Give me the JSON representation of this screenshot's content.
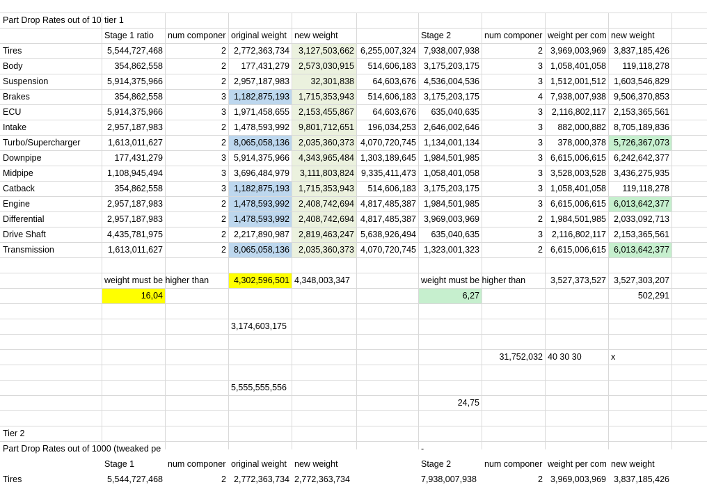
{
  "colors": {
    "grid": "#d9d9d9",
    "yellow": "#ffff00",
    "green_light": "#c6efce",
    "blue": "#bdd7ee",
    "olive": "#ebf1de"
  },
  "rows": [
    [
      {
        "c": 0,
        "t": "Part Drop Rates out of 10"
      },
      {
        "c": 1,
        "t": "tier 1",
        "a": "l"
      }
    ],
    [
      {
        "c": 1,
        "t": "Stage 1 ratio",
        "a": "l"
      },
      {
        "c": 2,
        "t": "num componer",
        "a": "l"
      },
      {
        "c": 3,
        "t": "original weight",
        "a": "l"
      },
      {
        "c": 4,
        "t": "new weight",
        "a": "l"
      },
      {
        "c": 6,
        "t": "Stage 2",
        "a": "l"
      },
      {
        "c": 7,
        "t": "num componer",
        "a": "l"
      },
      {
        "c": 8,
        "t": "weight per com",
        "a": "l"
      },
      {
        "c": 9,
        "t": "new weight",
        "a": "l"
      }
    ],
    [
      {
        "c": 0,
        "t": "Tires"
      },
      {
        "c": 1,
        "t": "5,544,727,468",
        "a": "r"
      },
      {
        "c": 2,
        "t": "2",
        "a": "r"
      },
      {
        "c": 3,
        "t": "2,772,363,734",
        "a": "r"
      },
      {
        "c": 4,
        "t": "3,127,503,662",
        "a": "r",
        "bg": "olive"
      },
      {
        "c": 5,
        "t": "6,255,007,324",
        "a": "r"
      },
      {
        "c": 6,
        "t": "7,938,007,938",
        "a": "r"
      },
      {
        "c": 7,
        "t": "2",
        "a": "r"
      },
      {
        "c": 8,
        "t": "3,969,003,969",
        "a": "r"
      },
      {
        "c": 9,
        "t": "3,837,185,426",
        "a": "r"
      }
    ],
    [
      {
        "c": 0,
        "t": "Body"
      },
      {
        "c": 1,
        "t": "354,862,558",
        "a": "r"
      },
      {
        "c": 2,
        "t": "2",
        "a": "r"
      },
      {
        "c": 3,
        "t": "177,431,279",
        "a": "r"
      },
      {
        "c": 4,
        "t": "2,573,030,915",
        "a": "r",
        "bg": "olive"
      },
      {
        "c": 5,
        "t": "514,606,183",
        "a": "r"
      },
      {
        "c": 6,
        "t": "3,175,203,175",
        "a": "r"
      },
      {
        "c": 7,
        "t": "3",
        "a": "r"
      },
      {
        "c": 8,
        "t": "1,058,401,058",
        "a": "r"
      },
      {
        "c": 9,
        "t": "119,118,278",
        "a": "r"
      }
    ],
    [
      {
        "c": 0,
        "t": "Suspension"
      },
      {
        "c": 1,
        "t": "5,914,375,966",
        "a": "r"
      },
      {
        "c": 2,
        "t": "2",
        "a": "r"
      },
      {
        "c": 3,
        "t": "2,957,187,983",
        "a": "r"
      },
      {
        "c": 4,
        "t": "32,301,838",
        "a": "r",
        "bg": "olive"
      },
      {
        "c": 5,
        "t": "64,603,676",
        "a": "r"
      },
      {
        "c": 6,
        "t": "4,536,004,536",
        "a": "r"
      },
      {
        "c": 7,
        "t": "3",
        "a": "r"
      },
      {
        "c": 8,
        "t": "1,512,001,512",
        "a": "r"
      },
      {
        "c": 9,
        "t": "1,603,546,829",
        "a": "r"
      }
    ],
    [
      {
        "c": 0,
        "t": "Brakes"
      },
      {
        "c": 1,
        "t": "354,862,558",
        "a": "r"
      },
      {
        "c": 2,
        "t": "3",
        "a": "r"
      },
      {
        "c": 3,
        "t": "1,182,875,193",
        "a": "r",
        "bg": "blue"
      },
      {
        "c": 4,
        "t": "1,715,353,943",
        "a": "r",
        "bg": "olive"
      },
      {
        "c": 5,
        "t": "514,606,183",
        "a": "r"
      },
      {
        "c": 6,
        "t": "3,175,203,175",
        "a": "r"
      },
      {
        "c": 7,
        "t": "4",
        "a": "r"
      },
      {
        "c": 8,
        "t": "7,938,007,938",
        "a": "r"
      },
      {
        "c": 9,
        "t": "9,506,370,853",
        "a": "r"
      }
    ],
    [
      {
        "c": 0,
        "t": "ECU"
      },
      {
        "c": 1,
        "t": "5,914,375,966",
        "a": "r"
      },
      {
        "c": 2,
        "t": "3",
        "a": "r"
      },
      {
        "c": 3,
        "t": "1,971,458,655",
        "a": "r"
      },
      {
        "c": 4,
        "t": "2,153,455,867",
        "a": "r",
        "bg": "olive"
      },
      {
        "c": 5,
        "t": "64,603,676",
        "a": "r"
      },
      {
        "c": 6,
        "t": "635,040,635",
        "a": "r"
      },
      {
        "c": 7,
        "t": "3",
        "a": "r"
      },
      {
        "c": 8,
        "t": "2,116,802,117",
        "a": "r"
      },
      {
        "c": 9,
        "t": "2,153,365,561",
        "a": "r"
      }
    ],
    [
      {
        "c": 0,
        "t": "Intake"
      },
      {
        "c": 1,
        "t": "2,957,187,983",
        "a": "r"
      },
      {
        "c": 2,
        "t": "2",
        "a": "r"
      },
      {
        "c": 3,
        "t": "1,478,593,992",
        "a": "r"
      },
      {
        "c": 4,
        "t": "9,801,712,651",
        "a": "r",
        "bg": "olive"
      },
      {
        "c": 5,
        "t": "196,034,253",
        "a": "r"
      },
      {
        "c": 6,
        "t": "2,646,002,646",
        "a": "r"
      },
      {
        "c": 7,
        "t": "3",
        "a": "r"
      },
      {
        "c": 8,
        "t": "882,000,882",
        "a": "r"
      },
      {
        "c": 9,
        "t": "8,705,189,836",
        "a": "r"
      }
    ],
    [
      {
        "c": 0,
        "t": "Turbo/Supercharger"
      },
      {
        "c": 1,
        "t": "1,613,011,627",
        "a": "r"
      },
      {
        "c": 2,
        "t": "2",
        "a": "r"
      },
      {
        "c": 3,
        "t": "8,065,058,136",
        "a": "r",
        "bg": "blue"
      },
      {
        "c": 4,
        "t": "2,035,360,373",
        "a": "r",
        "bg": "olive"
      },
      {
        "c": 5,
        "t": "4,070,720,745",
        "a": "r"
      },
      {
        "c": 6,
        "t": "1,134,001,134",
        "a": "r"
      },
      {
        "c": 7,
        "t": "3",
        "a": "r"
      },
      {
        "c": 8,
        "t": "378,000,378",
        "a": "r"
      },
      {
        "c": 9,
        "t": "5,726,367,073",
        "a": "r",
        "bg": "green_light"
      }
    ],
    [
      {
        "c": 0,
        "t": "Downpipe"
      },
      {
        "c": 1,
        "t": "177,431,279",
        "a": "r"
      },
      {
        "c": 2,
        "t": "3",
        "a": "r"
      },
      {
        "c": 3,
        "t": "5,914,375,966",
        "a": "r"
      },
      {
        "c": 4,
        "t": "4,343,965,484",
        "a": "r",
        "bg": "olive"
      },
      {
        "c": 5,
        "t": "1,303,189,645",
        "a": "r"
      },
      {
        "c": 6,
        "t": "1,984,501,985",
        "a": "r"
      },
      {
        "c": 7,
        "t": "3",
        "a": "r"
      },
      {
        "c": 8,
        "t": "6,615,006,615",
        "a": "r"
      },
      {
        "c": 9,
        "t": "6,242,642,377",
        "a": "r"
      }
    ],
    [
      {
        "c": 0,
        "t": "Midpipe"
      },
      {
        "c": 1,
        "t": "1,108,945,494",
        "a": "r"
      },
      {
        "c": 2,
        "t": "3",
        "a": "r"
      },
      {
        "c": 3,
        "t": "3,696,484,979",
        "a": "r"
      },
      {
        "c": 4,
        "t": "3,111,803,824",
        "a": "r",
        "bg": "olive"
      },
      {
        "c": 5,
        "t": "9,335,411,473",
        "a": "r"
      },
      {
        "c": 6,
        "t": "1,058,401,058",
        "a": "r"
      },
      {
        "c": 7,
        "t": "3",
        "a": "r"
      },
      {
        "c": 8,
        "t": "3,528,003,528",
        "a": "r"
      },
      {
        "c": 9,
        "t": "3,436,275,935",
        "a": "r"
      }
    ],
    [
      {
        "c": 0,
        "t": "Catback"
      },
      {
        "c": 1,
        "t": "354,862,558",
        "a": "r"
      },
      {
        "c": 2,
        "t": "3",
        "a": "r"
      },
      {
        "c": 3,
        "t": "1,182,875,193",
        "a": "r",
        "bg": "blue"
      },
      {
        "c": 4,
        "t": "1,715,353,943",
        "a": "r",
        "bg": "olive"
      },
      {
        "c": 5,
        "t": "514,606,183",
        "a": "r"
      },
      {
        "c": 6,
        "t": "3,175,203,175",
        "a": "r"
      },
      {
        "c": 7,
        "t": "3",
        "a": "r"
      },
      {
        "c": 8,
        "t": "1,058,401,058",
        "a": "r"
      },
      {
        "c": 9,
        "t": "119,118,278",
        "a": "r"
      }
    ],
    [
      {
        "c": 0,
        "t": "Engine"
      },
      {
        "c": 1,
        "t": "2,957,187,983",
        "a": "r"
      },
      {
        "c": 2,
        "t": "2",
        "a": "r"
      },
      {
        "c": 3,
        "t": "1,478,593,992",
        "a": "r",
        "bg": "blue"
      },
      {
        "c": 4,
        "t": "2,408,742,694",
        "a": "r",
        "bg": "olive"
      },
      {
        "c": 5,
        "t": "4,817,485,387",
        "a": "r"
      },
      {
        "c": 6,
        "t": "1,984,501,985",
        "a": "r"
      },
      {
        "c": 7,
        "t": "3",
        "a": "r"
      },
      {
        "c": 8,
        "t": "6,615,006,615",
        "a": "r"
      },
      {
        "c": 9,
        "t": "6,013,642,377",
        "a": "r",
        "bg": "green_light"
      }
    ],
    [
      {
        "c": 0,
        "t": "Differential"
      },
      {
        "c": 1,
        "t": "2,957,187,983",
        "a": "r"
      },
      {
        "c": 2,
        "t": "2",
        "a": "r"
      },
      {
        "c": 3,
        "t": "1,478,593,992",
        "a": "r",
        "bg": "blue"
      },
      {
        "c": 4,
        "t": "2,408,742,694",
        "a": "r",
        "bg": "olive"
      },
      {
        "c": 5,
        "t": "4,817,485,387",
        "a": "r"
      },
      {
        "c": 6,
        "t": "3,969,003,969",
        "a": "r"
      },
      {
        "c": 7,
        "t": "2",
        "a": "r"
      },
      {
        "c": 8,
        "t": "1,984,501,985",
        "a": "r"
      },
      {
        "c": 9,
        "t": "2,033,092,713",
        "a": "r"
      }
    ],
    [
      {
        "c": 0,
        "t": "Drive Shaft"
      },
      {
        "c": 1,
        "t": "4,435,781,975",
        "a": "r"
      },
      {
        "c": 2,
        "t": "2",
        "a": "r"
      },
      {
        "c": 3,
        "t": "2,217,890,987",
        "a": "r"
      },
      {
        "c": 4,
        "t": "2,819,463,247",
        "a": "r",
        "bg": "olive"
      },
      {
        "c": 5,
        "t": "5,638,926,494",
        "a": "r"
      },
      {
        "c": 6,
        "t": "635,040,635",
        "a": "r"
      },
      {
        "c": 7,
        "t": "3",
        "a": "r"
      },
      {
        "c": 8,
        "t": "2,116,802,117",
        "a": "r"
      },
      {
        "c": 9,
        "t": "2,153,365,561",
        "a": "r"
      }
    ],
    [
      {
        "c": 0,
        "t": "Transmission"
      },
      {
        "c": 1,
        "t": "1,613,011,627",
        "a": "r"
      },
      {
        "c": 2,
        "t": "2",
        "a": "r"
      },
      {
        "c": 3,
        "t": "8,065,058,136",
        "a": "r",
        "bg": "blue"
      },
      {
        "c": 4,
        "t": "2,035,360,373",
        "a": "r",
        "bg": "olive"
      },
      {
        "c": 5,
        "t": "4,070,720,745",
        "a": "r"
      },
      {
        "c": 6,
        "t": "1,323,001,323",
        "a": "r"
      },
      {
        "c": 7,
        "t": "2",
        "a": "r"
      },
      {
        "c": 8,
        "t": "6,615,006,615",
        "a": "r"
      },
      {
        "c": 9,
        "t": "6,013,642,377",
        "a": "r",
        "bg": "green_light"
      }
    ],
    [],
    [
      {
        "c": 1,
        "t": "weight must be higher than",
        "a": "l",
        "ovf": true
      },
      {
        "c": 3,
        "t": "4,302,596,501",
        "a": "r",
        "bg": "yellow"
      },
      {
        "c": 4,
        "t": "4,348,003,347",
        "a": "l"
      },
      {
        "c": 6,
        "t": "weight must be higher than",
        "a": "l",
        "ovf": true
      },
      {
        "c": 8,
        "t": "3,527,373,527",
        "a": "r"
      },
      {
        "c": 9,
        "t": "3,527,303,207",
        "a": "r"
      }
    ],
    [
      {
        "c": 1,
        "t": "16,04",
        "a": "r",
        "bg": "yellow"
      },
      {
        "c": 6,
        "t": "6,27",
        "a": "r",
        "bg": "green_light"
      },
      {
        "c": 9,
        "t": "502,291",
        "a": "r"
      }
    ],
    [],
    [
      {
        "c": 3,
        "t": "3,174,603,175",
        "a": "l"
      }
    ],
    [],
    [
      {
        "c": 7,
        "t": "31,752,032",
        "a": "r"
      },
      {
        "c": 8,
        "t": "40 30 30",
        "a": "l"
      },
      {
        "c": 9,
        "t": "x",
        "a": "l"
      }
    ],
    [],
    [
      {
        "c": 3,
        "t": "5,555,555,556",
        "a": "l"
      }
    ],
    [
      {
        "c": 5,
        "t": "24,75",
        "a": "r",
        "span": 2
      }
    ],
    [],
    [
      {
        "c": 0,
        "t": "Tier 2"
      }
    ],
    [
      {
        "c": 0,
        "t": "Part Drop Rates out of 1000 (tweaked pe",
        "span": 2
      },
      {
        "c": 6,
        "t": "-",
        "a": "l"
      }
    ],
    [
      {
        "c": 1,
        "t": "Stage 1",
        "a": "l"
      },
      {
        "c": 2,
        "t": "num componer",
        "a": "l"
      },
      {
        "c": 3,
        "t": "original weight",
        "a": "l"
      },
      {
        "c": 4,
        "t": "new weight",
        "a": "l"
      },
      {
        "c": 6,
        "t": "Stage 2",
        "a": "l"
      },
      {
        "c": 7,
        "t": "num componer",
        "a": "l"
      },
      {
        "c": 8,
        "t": "weight per com",
        "a": "l"
      },
      {
        "c": 9,
        "t": "new weight",
        "a": "l"
      }
    ],
    [
      {
        "c": 0,
        "t": "Tires"
      },
      {
        "c": 1,
        "t": "5,544,727,468",
        "a": "r"
      },
      {
        "c": 2,
        "t": "2",
        "a": "r"
      },
      {
        "c": 3,
        "t": "2,772,363,734",
        "a": "r"
      },
      {
        "c": 4,
        "t": "2,772,363,734",
        "a": "l"
      },
      {
        "c": 6,
        "t": "7,938,007,938",
        "a": "l"
      },
      {
        "c": 7,
        "t": "2",
        "a": "r"
      },
      {
        "c": 8,
        "t": "3,969,003,969",
        "a": "r"
      },
      {
        "c": 9,
        "t": "3,837,185,426",
        "a": "r"
      }
    ]
  ]
}
